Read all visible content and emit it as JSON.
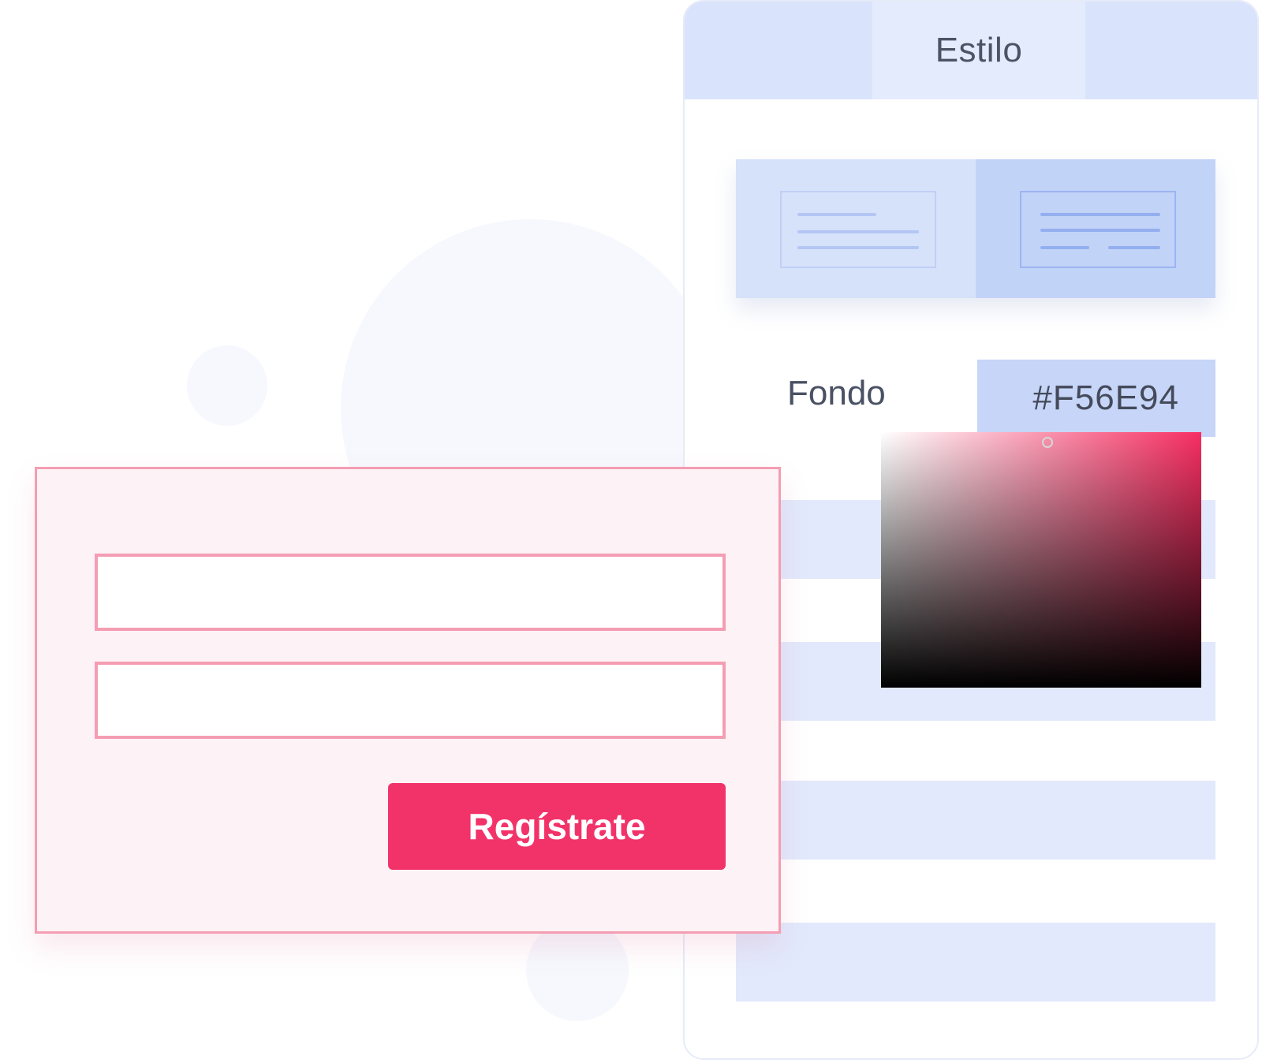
{
  "panel": {
    "tabs": [
      {
        "label": ""
      },
      {
        "label": "Estilo",
        "active": true
      },
      {
        "label": ""
      }
    ],
    "layout_options": [
      {
        "name": "layout-1",
        "selected": false
      },
      {
        "name": "layout-2",
        "selected": true
      }
    ],
    "background_field": {
      "label": "Fondo",
      "value": "#F56E94"
    },
    "color_picker": {
      "hue_color": "#F72E62"
    }
  },
  "form_preview": {
    "inputs": [
      {
        "placeholder": ""
      },
      {
        "placeholder": ""
      }
    ],
    "submit_label": "Regístrate"
  },
  "colors": {
    "accent": "#F2336A",
    "form_border": "#F49DB3",
    "form_background": "#FDF2F6",
    "panel_tab_background": "#D9E3FC",
    "active_tab_background": "#E4EBFD",
    "input_background": "#C6D5F8"
  }
}
